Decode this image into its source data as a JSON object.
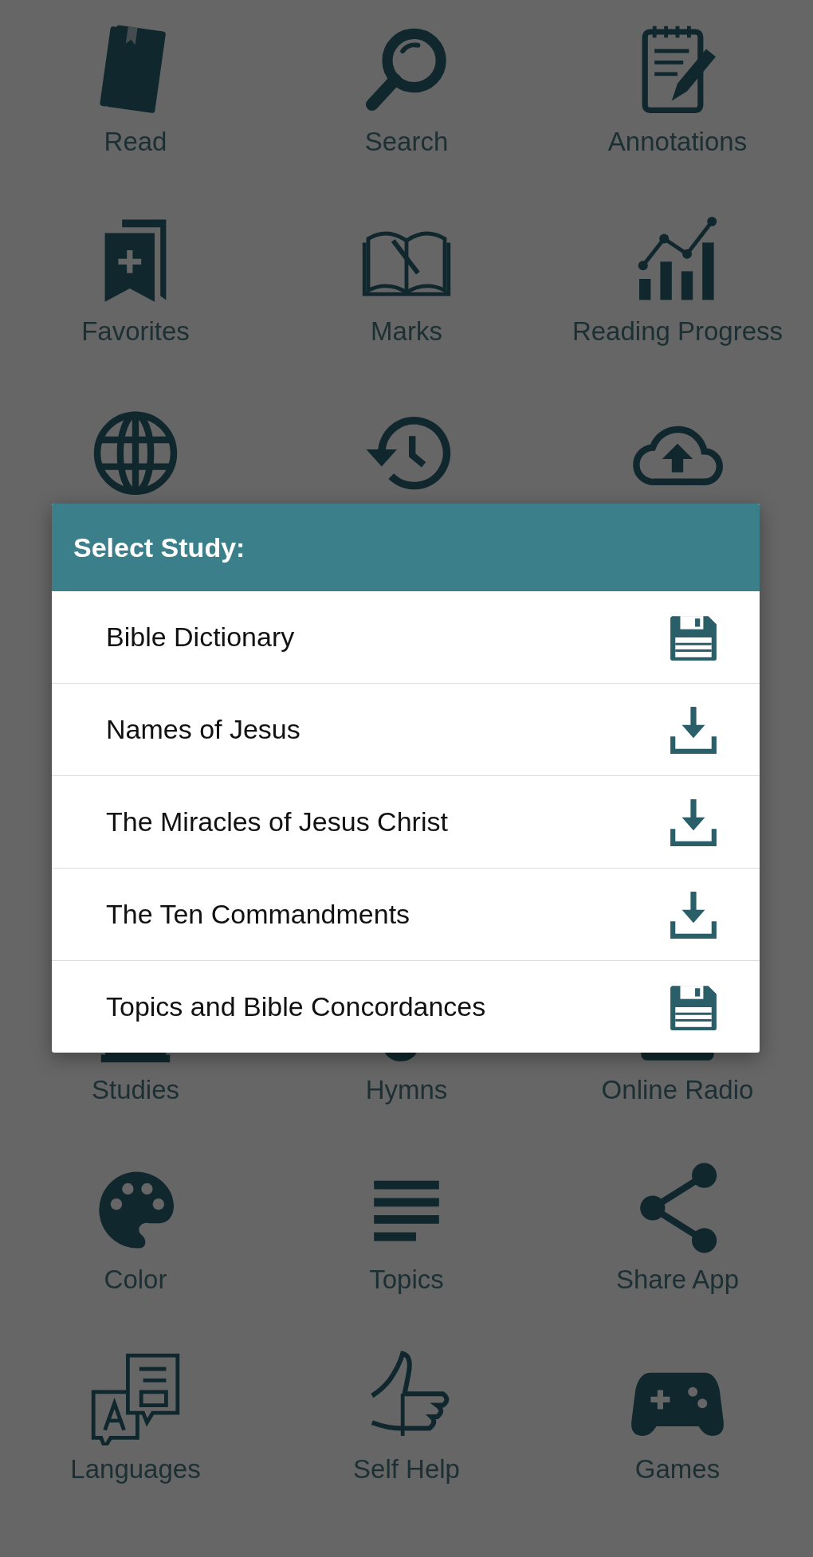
{
  "menu_top": [
    {
      "kind": "labeled",
      "label": "Read"
    },
    {
      "kind": "labeled",
      "label": "Search"
    },
    {
      "kind": "labeled",
      "label": "Annotations"
    },
    {
      "kind": "labeled",
      "label": "Favorites"
    },
    {
      "kind": "labeled",
      "label": "Marks"
    },
    {
      "kind": "labeled",
      "label": "Reading Progress"
    },
    {
      "kind": "icon"
    },
    {
      "kind": "icon"
    },
    {
      "kind": "icon"
    }
  ],
  "menu_bottom": [
    {
      "kind": "labeled",
      "label": "Studies"
    },
    {
      "kind": "labeled",
      "label": "Hymns"
    },
    {
      "kind": "labeled",
      "label": "Online Radio"
    },
    {
      "kind": "labeled",
      "label": "Color"
    },
    {
      "kind": "labeled",
      "label": "Topics"
    },
    {
      "kind": "labeled",
      "label": "Share App"
    },
    {
      "kind": "labeled",
      "label": "Languages"
    },
    {
      "kind": "labeled",
      "label": "Self Help"
    },
    {
      "kind": "labeled",
      "label": "Games"
    }
  ],
  "dialog": {
    "title": "Select Study:",
    "items": [
      {
        "label": "Bible Dictionary",
        "downloaded": true
      },
      {
        "label": "Names of Jesus",
        "downloaded": false
      },
      {
        "label": "The Miracles of Jesus Christ",
        "downloaded": false
      },
      {
        "label": "The Ten Commandments",
        "downloaded": false
      },
      {
        "label": "Topics and Bible Concordances",
        "downloaded": true
      }
    ]
  }
}
